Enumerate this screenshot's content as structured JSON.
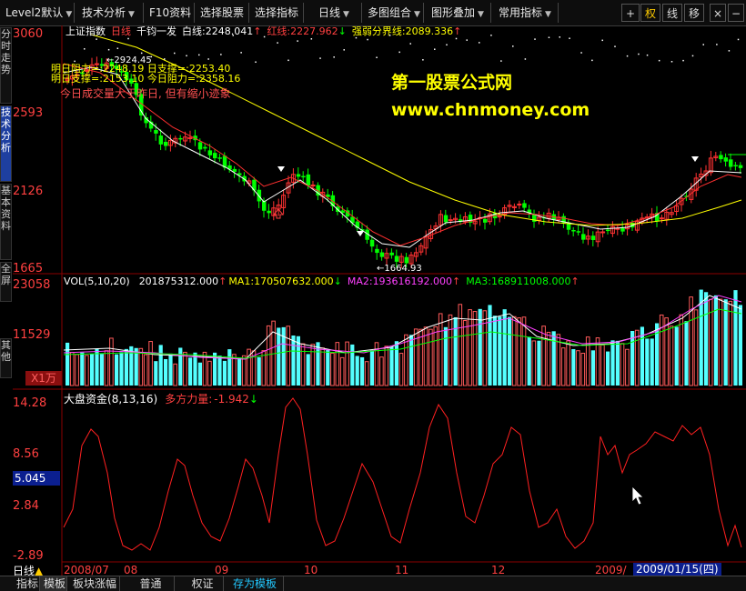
{
  "toolbar": {
    "items": [
      {
        "label": "Level2默认"
      },
      {
        "label": "技术分析"
      },
      {
        "label": "F10资料"
      },
      {
        "label": "选择股票"
      },
      {
        "label": "选择指标"
      },
      {
        "label": "日线"
      },
      {
        "label": "多图组合"
      },
      {
        "label": "图形叠加"
      },
      {
        "label": "常用指标"
      }
    ],
    "buttons": {
      "add": "+",
      "quan": "权",
      "xian": "线",
      "yi": "移",
      "close": "×",
      "minus": "−"
    }
  },
  "left_tabs": [
    "分时走势",
    "技术分析",
    "基本资料",
    "全屏",
    "其他"
  ],
  "price_pane": {
    "header": {
      "index_name": "上证指数",
      "period": "日线",
      "indicator": "千钧一发",
      "white_line_label": "白线:",
      "white_line_value": "2248.041",
      "white_arrow": "↑",
      "red_line_label": "红线:",
      "red_line_value": "2227.962",
      "red_arrow": "↓",
      "strong_weak_label": "强弱分界线:",
      "strong_weak_value": "2089.336",
      "strong_weak_arrow": "↑"
    },
    "notes": [
      {
        "text": "明日阻力=:2248.19  日支撑=:2253.40",
        "color": "#ffff00"
      },
      {
        "text": "明日支撑=:2153.10  今日阻力=:2358.16",
        "color": "#ffff00"
      },
      {
        "text": "今日成交量大于昨日, 但有缩小迹象",
        "color": "#ff5050"
      }
    ],
    "high_label": "2924.45",
    "low_label": "1664.93",
    "y_ticks": [
      "3060",
      "2593",
      "2126",
      "1665"
    ],
    "watermark_title": "第一股票公式网",
    "watermark_url": "www.chnmoney.com"
  },
  "volume_pane": {
    "header": {
      "name": "VOL(5,10,20)",
      "vol": "201875312.000",
      "vol_arrow": "↑",
      "ma1_label": "MA1:",
      "ma1": "170507632.000",
      "ma1_arrow": "↓",
      "ma2_label": "MA2:",
      "ma2": "193616192.000",
      "ma2_arrow": "↑",
      "ma3_label": "MA3:",
      "ma3": "168911008.000",
      "ma3_arrow": "↑"
    },
    "y_ticks": [
      "23058",
      "11529"
    ],
    "unit": "X1万"
  },
  "indicator_pane": {
    "header": {
      "name": "大盘资金",
      "params": "(8,13,16)",
      "force_label": "多方力量:",
      "force_value": "-1.942",
      "force_arrow": "↓"
    },
    "y_ticks": [
      "14.28",
      "8.56",
      "2.84",
      "-2.89"
    ],
    "cursor_value": "5.045"
  },
  "x_axis": {
    "labels": [
      "2008/07",
      "08",
      "09",
      "10",
      "11",
      "12",
      "2009/"
    ],
    "cursor_date": "2009/01/15(四)"
  },
  "status": {
    "period": "日线",
    "warn": "▲"
  },
  "bottom_tabs": [
    "指标",
    "模板",
    "板块涨幅",
    "普通",
    "权证",
    "存为模板"
  ],
  "colors": {
    "up": "#ff3232",
    "down": "#00ff00",
    "vol_down": "#54ffff",
    "accent": "#ffff00"
  }
}
